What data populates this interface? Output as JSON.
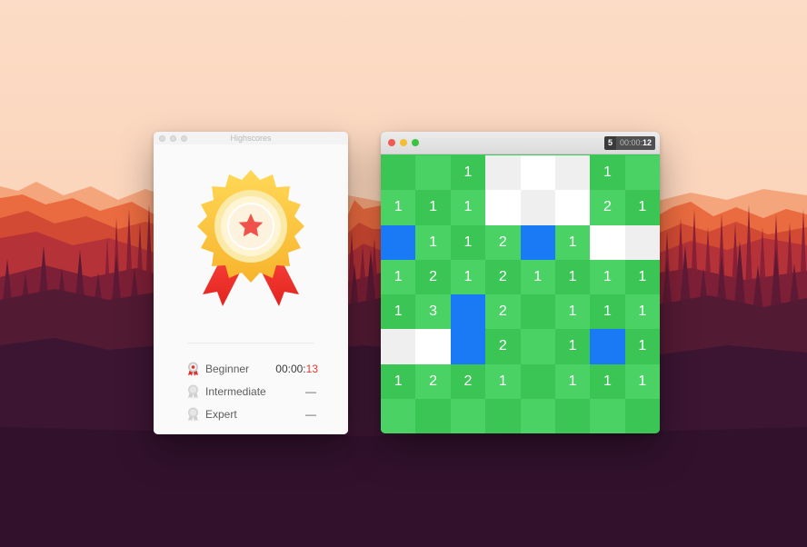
{
  "highscores_window": {
    "title": "Highscores",
    "rows": [
      {
        "label": "Beginner",
        "time_prefix": "00:00:",
        "time_seconds": "13",
        "medal": "ribbon-medal-icon"
      },
      {
        "label": "Intermediate",
        "time_prefix": "",
        "time_seconds": "—",
        "medal": "gray-medal-icon"
      },
      {
        "label": "Expert",
        "time_prefix": "",
        "time_seconds": "—",
        "medal": "gray-medal-icon"
      }
    ]
  },
  "game_window": {
    "mine_count": "5",
    "timer_prefix": "00:00:",
    "timer_seconds": "12",
    "board": [
      [
        "g",
        "g",
        "1",
        "w",
        "w",
        "w",
        "1",
        "g"
      ],
      [
        "1",
        "1",
        "1",
        "w",
        "w",
        "w",
        "2",
        "1"
      ],
      [
        "b",
        "1",
        "1",
        "2",
        "b",
        "1",
        "w",
        "w"
      ],
      [
        "1",
        "2",
        "1",
        "2",
        "1",
        "1",
        "1",
        "1"
      ],
      [
        "1",
        "3",
        "b",
        "2",
        "g",
        "1",
        "1",
        "1"
      ],
      [
        "w",
        "w",
        "b",
        "2",
        "g",
        "1",
        "b",
        "1"
      ],
      [
        "1",
        "2",
        "2",
        "1",
        "g",
        "1",
        "1",
        "1"
      ],
      [
        "g",
        "g",
        "g",
        "g",
        "g",
        "g",
        "g",
        "g"
      ]
    ],
    "legend": {
      "g": "unrevealed",
      "w": "revealed-empty",
      "b": "flagged",
      "digits": "revealed-count"
    }
  },
  "colors": {
    "green_dark": "#3ac554",
    "green_light": "#4ad264",
    "revealed_white": "#ffffff",
    "revealed_gray": "#efefef",
    "flag_blue": "#1a7af5",
    "accent_red": "#e9382c",
    "sky": "#fbd9c1"
  }
}
